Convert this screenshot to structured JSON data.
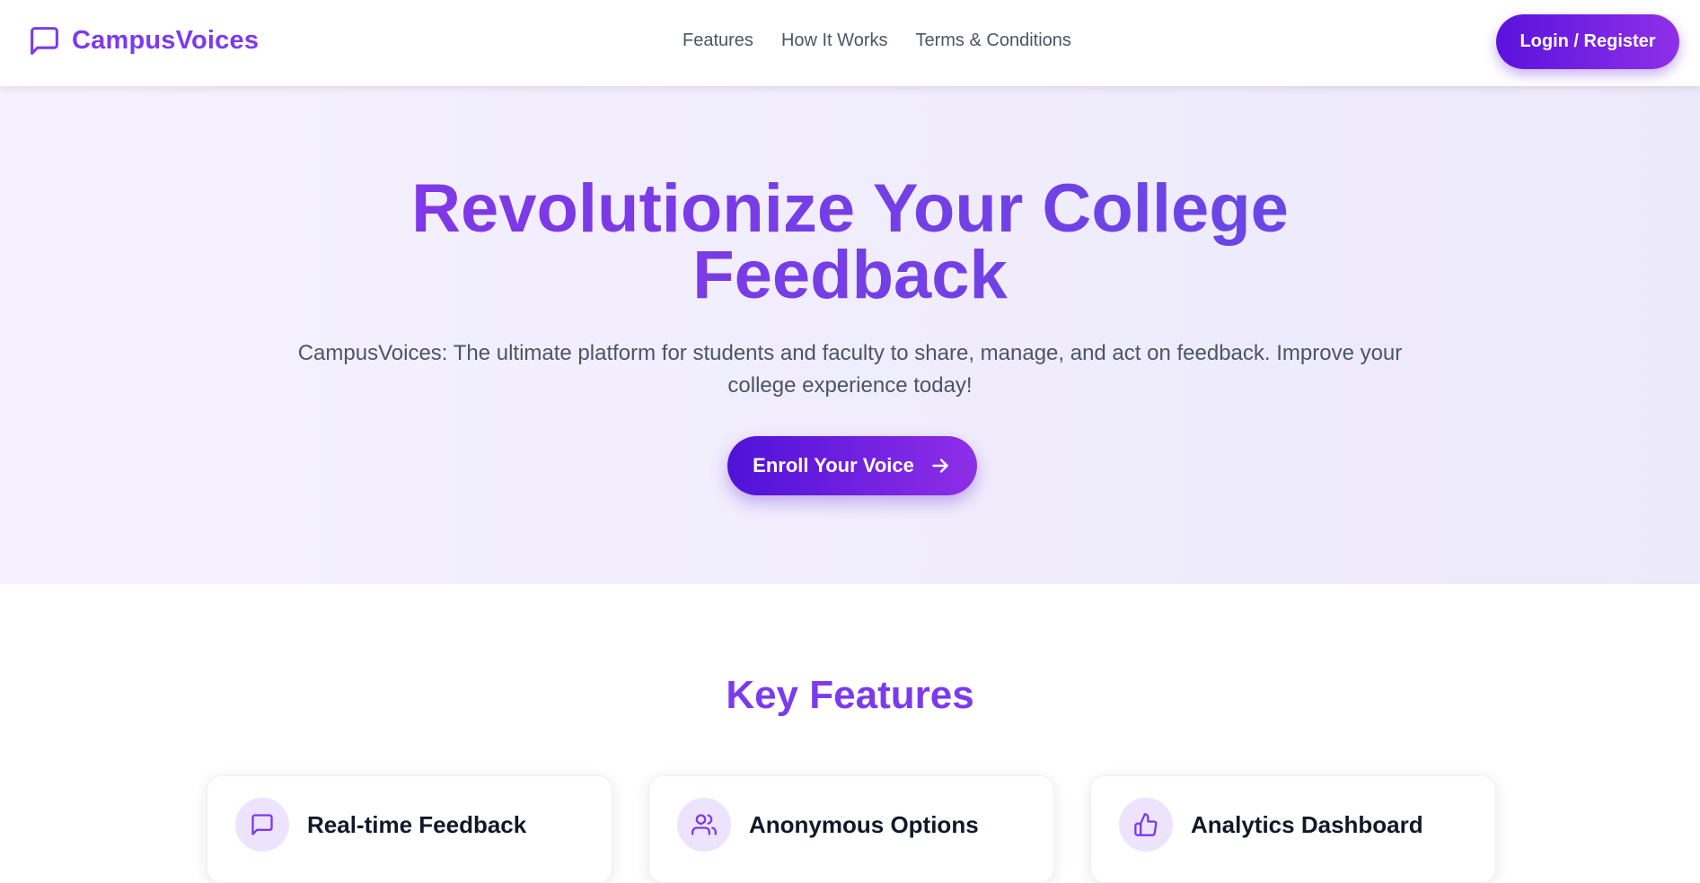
{
  "header": {
    "brand": "CampusVoices",
    "nav": [
      "Features",
      "How It Works",
      "Terms & Conditions"
    ],
    "login_label": "Login / Register"
  },
  "hero": {
    "title_line1": "Revolutionize Your College",
    "title_line2": "Feedback",
    "subtitle": "CampusVoices: The ultimate platform for students and faculty to share, manage, and act on feedback. Improve your college experience today!",
    "cta_label": "Enroll Your Voice"
  },
  "features": {
    "title": "Key Features",
    "cards": [
      {
        "title": "Real-time Feedback",
        "icon": "chat-icon"
      },
      {
        "title": "Anonymous Options",
        "icon": "users-icon"
      },
      {
        "title": "Analytics Dashboard",
        "icon": "thumbs-up-icon"
      }
    ]
  },
  "theme": {
    "accent": "#7c3aed",
    "button_gradient_start": "#5b12dd",
    "button_gradient_end": "#8f30e8",
    "hero_bg_left": "#f5f1fe",
    "hero_bg_right": "#ece9fb"
  }
}
